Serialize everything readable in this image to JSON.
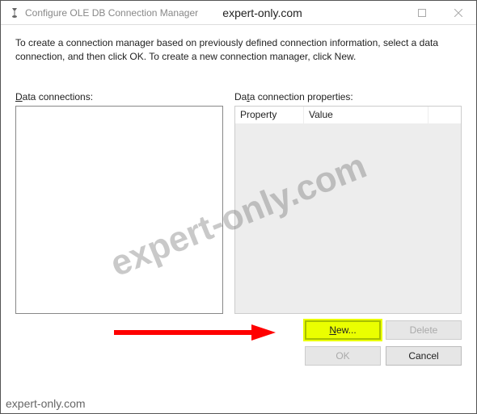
{
  "titlebar": {
    "title": "Configure OLE DB Connection Manager",
    "brand": "expert-only.com"
  },
  "instructions": "To create a connection manager based on previously defined connection information, select a data connection, and then click OK. To create a new connection manager, click New.",
  "labels": {
    "data_connections_prefix": "D",
    "data_connections_rest": "ata connections:",
    "data_properties_prefix": "Da",
    "data_properties_underline": "t",
    "data_properties_rest": "a connection properties:"
  },
  "table": {
    "col_property": "Property",
    "col_value": "Value"
  },
  "buttons": {
    "new_underline": "N",
    "new_rest": "ew...",
    "delete": "Delete",
    "ok": "OK",
    "cancel": "Cancel"
  },
  "watermark": "expert-only.com",
  "footer": "expert-only.com"
}
